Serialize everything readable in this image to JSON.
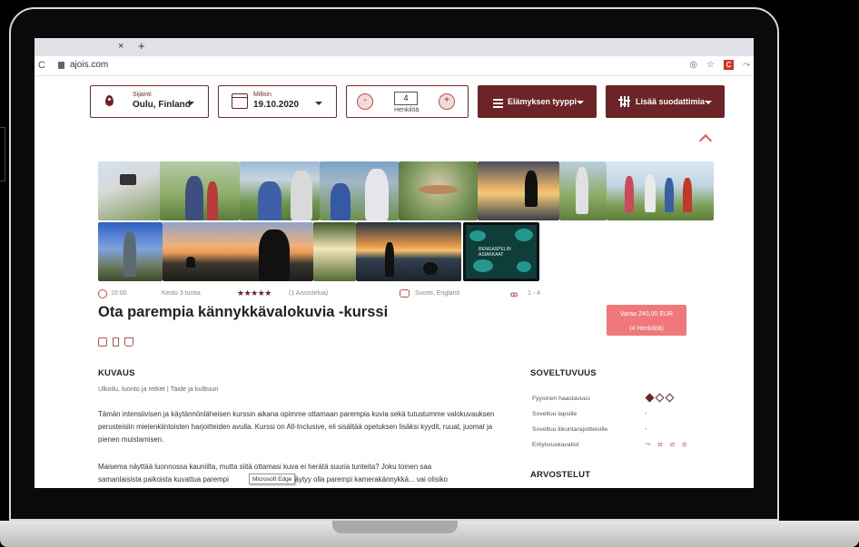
{
  "browser": {
    "tab_close": "×",
    "tab_new": "+",
    "reload": "C",
    "url": "ajois.com",
    "ext_badge": "C",
    "tooltip": "Microsoft Edge"
  },
  "filters": {
    "location_label": "Sijainti",
    "location_value": "Oulu, Finland",
    "date_label": "Milloin",
    "date_value": "19.10.2020",
    "minus": "-",
    "plus": "+",
    "persons_count": "4",
    "persons_label": "Henkilöä",
    "type_label": "Elämyksen tyyppi",
    "more_label": "Lisää suodattimia"
  },
  "meta": {
    "time": "10:00",
    "duration": "Kesto 3 tuntia",
    "stars": "★★★★★",
    "rating": "(1 Arvostelua)",
    "languages": "Suomi, Englanti",
    "group_size": "1 - 4"
  },
  "experience": {
    "title": "Ota parempia kännykkävalokuvia -kurssi",
    "book_line1": "Varaa 240,00 EUR",
    "book_line2": "(4 Henkilöä)",
    "poster_text": "RENGASPELIN ASIAKKAAT"
  },
  "description": {
    "heading": "KUVAUS",
    "categories": "Ulkoilu, luonto ja retket  |  Taide ja kulttuuri",
    "para1": "Tämän intensiivisen ja käytännönläheisen kurssin aikana opimme ottamaan parempia kuvia sekä tutustumme valokuvauksen perusteisiin mielenkiintoisten harjoitteiden avulla. Kurssi on All-Inclusive, eli sisältää opetuksen lisäksi kyydit, ruuat, juomat ja pienen muistamisen.",
    "para2a": "Maisema näyttää luonnossa kauniilta, mutta siitä ottamasi kuva ei herätä suuria tunteita? Joku toinen saa",
    "para2b": "samanlaisista paikoista kuvattua parempi",
    "para2c": "ellä täytyy olla parempi kamerakännykkä... vai olisiko"
  },
  "suitability": {
    "heading": "SOVELTUVUUS",
    "rows": [
      {
        "label": "Fyysinen haastavuus",
        "value": ""
      },
      {
        "label": "Soveltuu lapsille",
        "value": "-"
      },
      {
        "label": "Soveltuu liikuntarajoitteisille",
        "value": "-"
      },
      {
        "label": "Erityisruokavaliot",
        "value": ""
      }
    ],
    "difficulty_level": 1,
    "difficulty_max": 3,
    "diet_icons": "⤳ ⧄ ⧄ ⊗",
    "reviews_heading": "ARVOSTELUT"
  },
  "colors": {
    "brand": "#6d2426",
    "accent": "#f0787a",
    "accent_icon": "#c0504d"
  }
}
